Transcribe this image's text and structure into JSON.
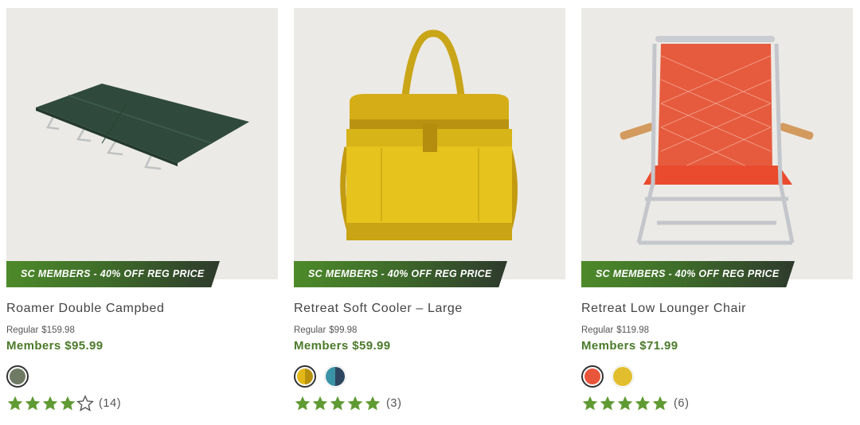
{
  "products": [
    {
      "badge": "SC MEMBERS - 40% OFF REG PRICE",
      "title": "Roamer Double Campbed",
      "regular_label": "Regular",
      "regular_price": "$159.98",
      "members_price": "Members $95.99",
      "swatches": [
        {
          "colors": [
            "#6f7a65"
          ],
          "selected": true
        }
      ],
      "rating": 4,
      "rating_max": 5,
      "review_count": "(14)"
    },
    {
      "badge": "SC MEMBERS - 40% OFF REG PRICE",
      "title": "Retreat Soft Cooler – Large",
      "regular_label": "Regular",
      "regular_price": "$99.98",
      "members_price": "Members $59.99",
      "swatches": [
        {
          "colors": [
            "#e3b816",
            "#b8910c"
          ],
          "selected": true
        },
        {
          "colors": [
            "#3a93a6",
            "#2e4660"
          ],
          "selected": false
        }
      ],
      "rating": 5,
      "rating_max": 5,
      "review_count": "(3)"
    },
    {
      "badge": "SC MEMBERS - 40% OFF REG PRICE",
      "title": "Retreat Low Lounger Chair",
      "regular_label": "Regular",
      "regular_price": "$119.98",
      "members_price": "Members $71.99",
      "swatches": [
        {
          "colors": [
            "#e8553a"
          ],
          "selected": true
        },
        {
          "colors": [
            "#e2be2e"
          ],
          "selected": false
        }
      ],
      "rating": 5,
      "rating_max": 5,
      "review_count": "(6)"
    }
  ],
  "colors": {
    "star_filled": "#5f9a33",
    "members_price": "#4b7a2a",
    "badge_start": "#4d8a2a",
    "badge_end": "#2e3a2c"
  }
}
